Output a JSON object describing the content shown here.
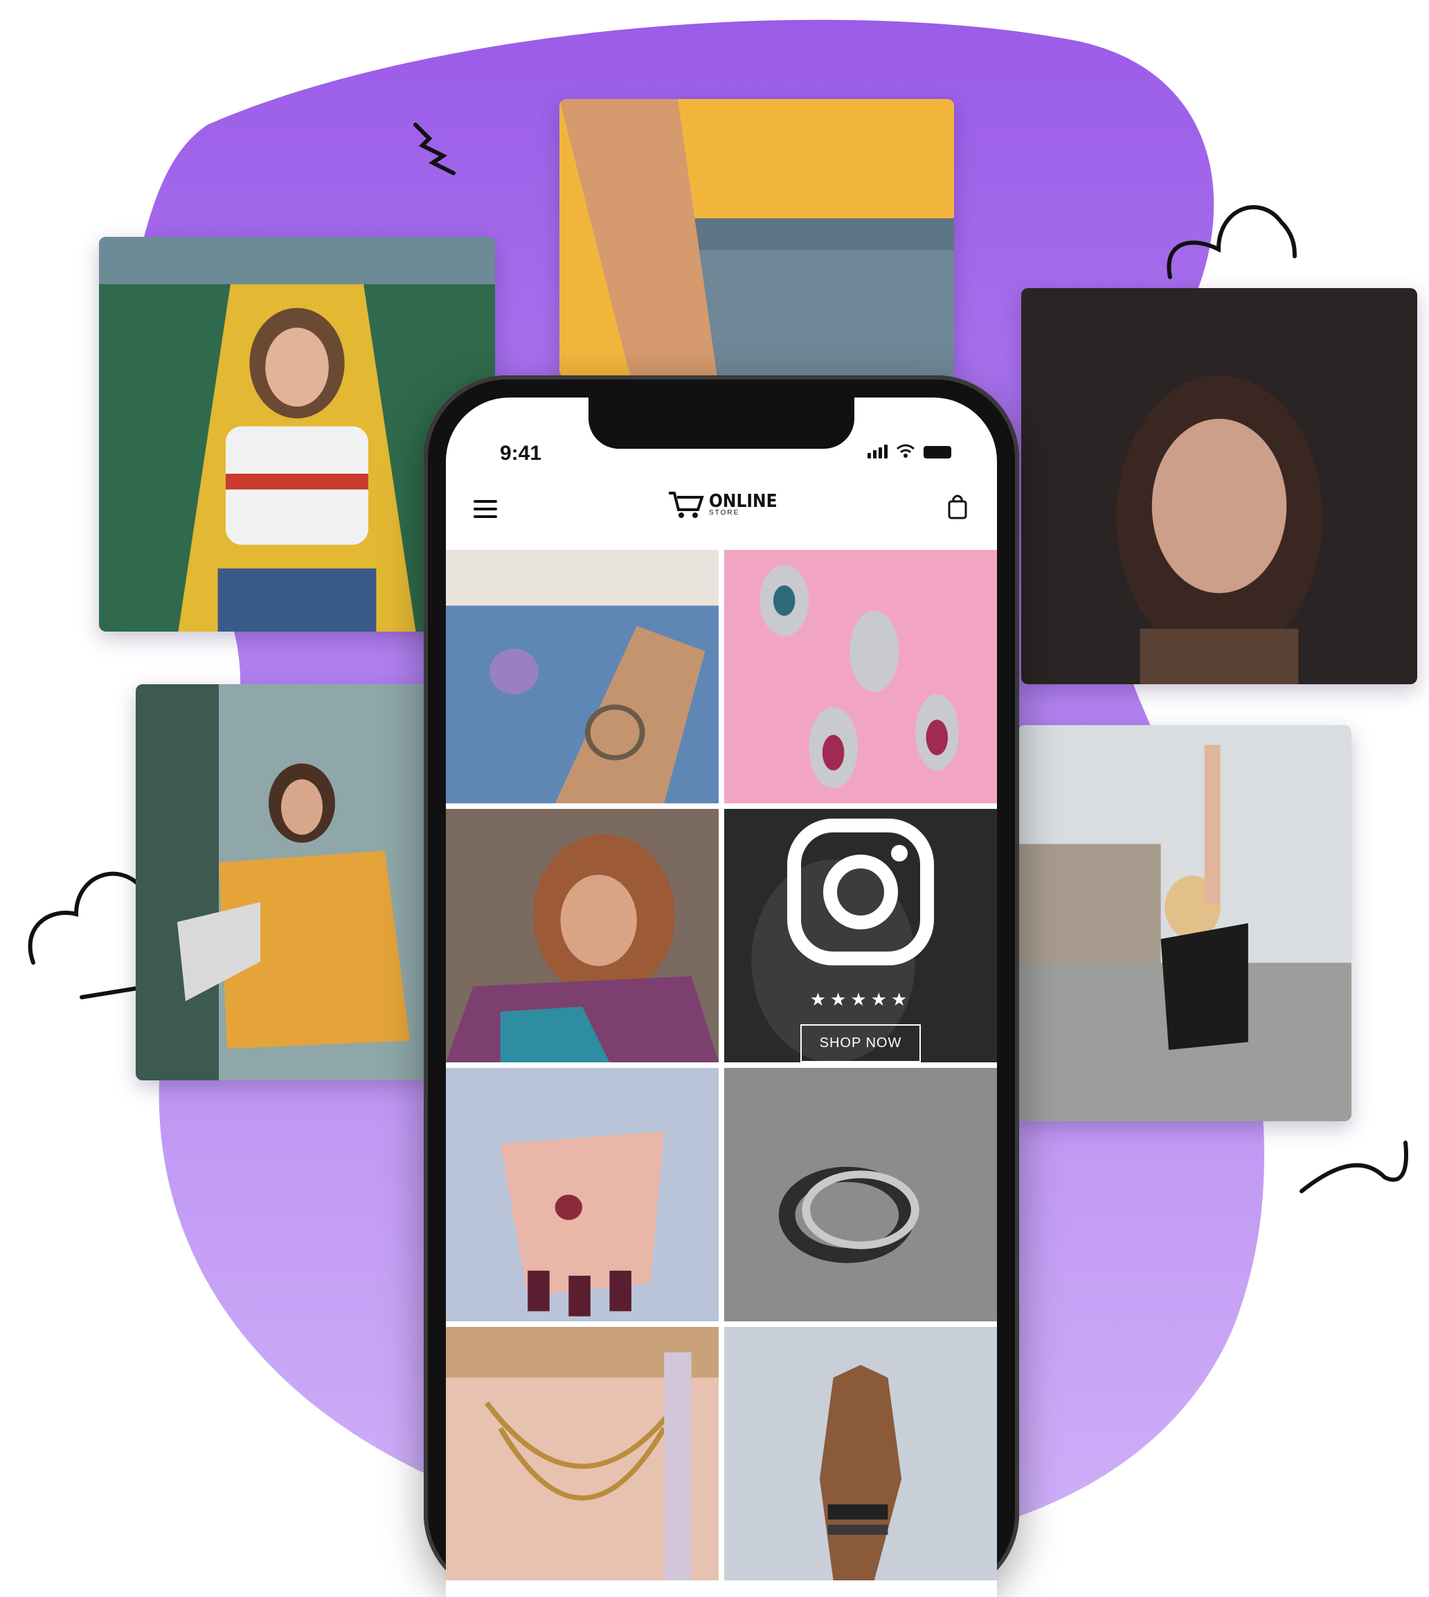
{
  "colors": {
    "blob_top": "#9b5ce8",
    "blob_bottom": "#c8a6f7",
    "phone_frame": "#111111",
    "accent": "#8e4de4"
  },
  "status_bar": {
    "time": "9:41",
    "icons": [
      "signal-icon",
      "wifi-icon",
      "battery-icon"
    ]
  },
  "app_header": {
    "logo_title": "ONLINE",
    "logo_subtitle": "STORE",
    "icons": [
      "menu-icon",
      "cart-logo-icon",
      "shopping-bag-icon"
    ]
  },
  "promo": {
    "rating": "★★★★★",
    "button_label": "SHOP NOW",
    "icon": "instagram-icon"
  },
  "grid_tiles": [
    "denim-bracelet-photo",
    "earrings-photo",
    "portrait-photo",
    "promo-tile",
    "hands-ring-photo",
    "rings-photo",
    "necklace-photo",
    "raised-hand-photo"
  ],
  "floating_photos": [
    "levis-girl-photo",
    "yellow-top-photo",
    "dark-portrait-photo",
    "yellow-sweater-photo",
    "arms-up-photo"
  ]
}
